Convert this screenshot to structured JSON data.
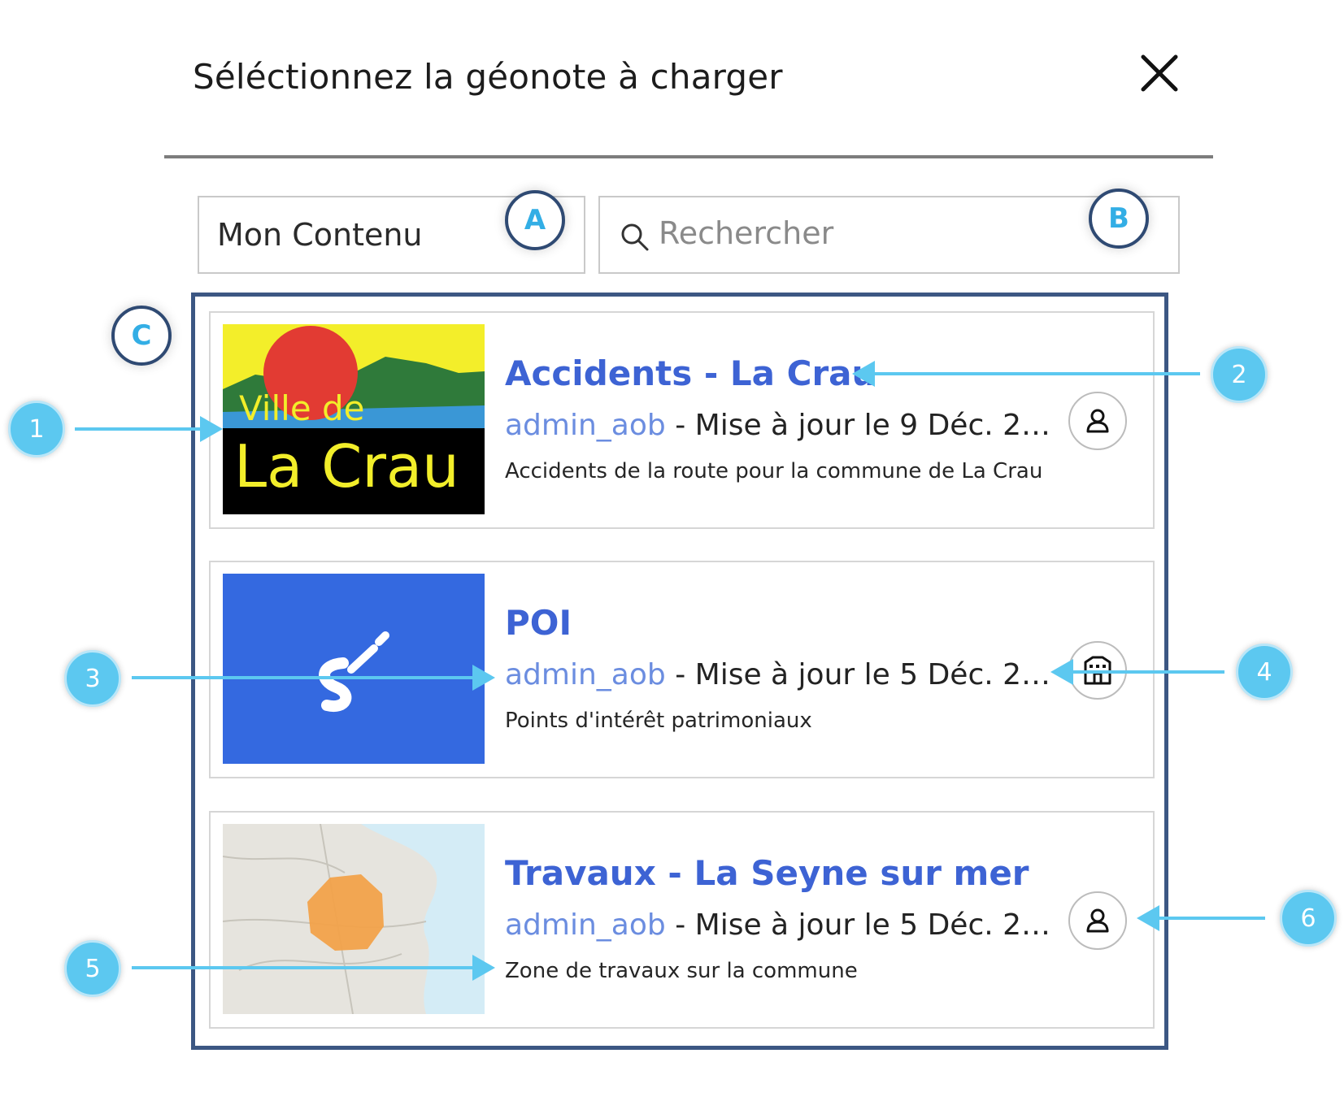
{
  "dialog": {
    "title": "Séléctionnez la géonote à charger"
  },
  "filter": {
    "selected": "Mon Contenu"
  },
  "search": {
    "placeholder": "Rechercher"
  },
  "markers": {
    "a": "A",
    "b": "B",
    "c": "C"
  },
  "items": [
    {
      "title": "Accidents - La Crau",
      "owner": "admin_aob",
      "separator": " - ",
      "updated": "Mise à jour  le 9 Déc. 2…",
      "description": "Accidents de la route pour la commune de La Crau",
      "thumb_text_1": "Ville de",
      "thumb_text_2": "La Crau",
      "share_icon": "user-icon"
    },
    {
      "title": "POI",
      "owner": "admin_aob",
      "separator": " - ",
      "updated": "Mise à jour  le 5 Déc. 2…",
      "description": "Points d'intérêt patrimoniaux",
      "share_icon": "building-icon"
    },
    {
      "title": "Travaux - La Seyne sur mer",
      "owner": "admin_aob",
      "separator": " - ",
      "updated": "Mise à jour  le 5 Déc. 2…",
      "description": "Zone de travaux sur la commune",
      "share_icon": "user-icon"
    }
  ],
  "callouts": [
    "1",
    "2",
    "3",
    "4",
    "5",
    "6"
  ],
  "colors": {
    "title_blue": "#3d63d4",
    "owner_blue": "#6b8de0",
    "callout_blue": "#5cc8f0",
    "marker_border": "#2f4a73",
    "panel_border": "#3c5783"
  }
}
